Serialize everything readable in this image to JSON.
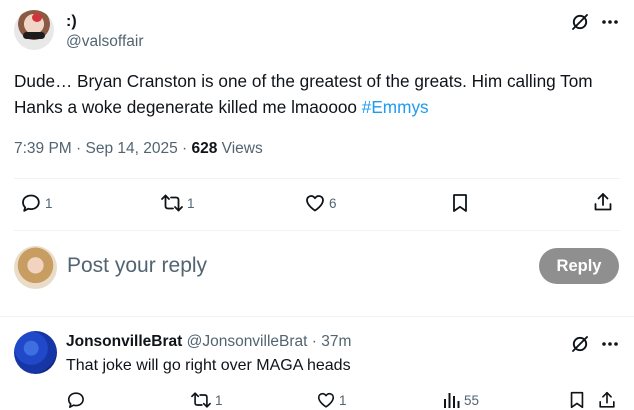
{
  "post": {
    "display_name": ":)",
    "handle": "@valsoffair",
    "body_text": "Dude… Bryan Cranston is one of the greatest of the greats. Him calling Tom Hanks a woke degenerate killed me lmaoooo",
    "hashtag": "#Emmys",
    "timestamp": "7:39 PM · Sep 14, 2025 · ",
    "views_count": "628",
    "views_label": " Views",
    "actions": {
      "reply_count": "1",
      "repost_count": "1",
      "like_count": "6"
    }
  },
  "composer": {
    "placeholder": "Post your reply",
    "button_label": "Reply"
  },
  "comment": {
    "display_name": "JonsonvilleBrat",
    "handle": "@JonsonvilleBrat",
    "separator": " · ",
    "time_ago": "37m",
    "body_text": "That joke will go right over MAGA heads",
    "actions": {
      "repost_count": "1",
      "like_count": "1",
      "views_count": "55"
    }
  },
  "colors": {
    "accent": "#1d9bf0",
    "text": "#0f1419",
    "muted": "#536471",
    "reply_button_bg": "#8f8f8f",
    "divider": "#eff3f4"
  },
  "icons": {
    "grok": "grok-icon",
    "more": "more-dots-icon",
    "reply": "speech-bubble-icon",
    "repost": "repost-arrows-icon",
    "like": "heart-icon",
    "bookmark": "bookmark-icon",
    "share": "share-upload-icon",
    "views": "bar-chart-icon"
  }
}
